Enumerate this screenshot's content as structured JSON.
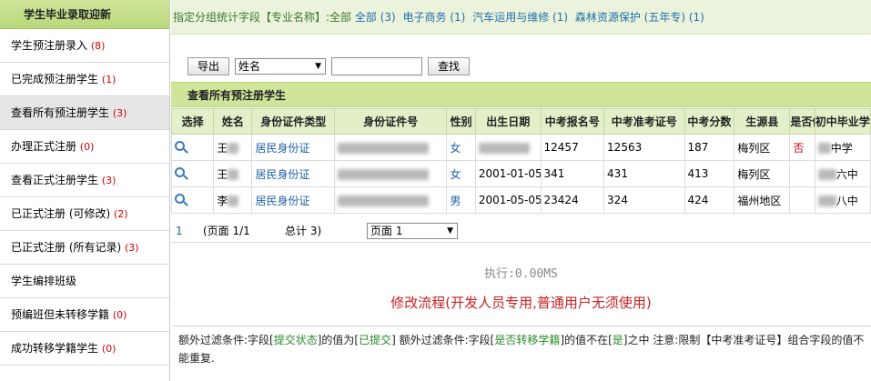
{
  "sidebar": {
    "header": "学生毕业录取迎新",
    "items": [
      {
        "label": "学生预注册录入",
        "count": "(8)"
      },
      {
        "label": "已完成预注册学生",
        "count": "(1)"
      },
      {
        "label": "查看所有预注册学生",
        "count": "(3)"
      },
      {
        "label": "办理正式注册",
        "count": "(0)"
      },
      {
        "label": "查看正式注册学生",
        "count": "(3)"
      },
      {
        "label": "已正式注册 (可修改)",
        "count": "(2)"
      },
      {
        "label": "已正式注册 (所有记录)",
        "count": "(3)"
      },
      {
        "label": "学生编排班级",
        "count": ""
      },
      {
        "label": "预编班但未转移学籍",
        "count": "(0)"
      },
      {
        "label": "成功转移学籍学生",
        "count": "(0)"
      }
    ]
  },
  "filterbar": {
    "prefix": "指定分组统计字段【专业名称】:全部",
    "links": [
      "全部 (3)",
      "电子商务 (1)",
      "汽车运用与维修 (1)",
      "森林资源保护 (五年专) (1)"
    ]
  },
  "toolbar": {
    "export_label": "导出",
    "field_select": "姓名",
    "search_value": "",
    "search_label": "查找"
  },
  "grid": {
    "title": "查看所有预注册学生",
    "columns": [
      "选择",
      "姓名",
      "身份证件类型",
      "身份证件号",
      "性别",
      "出生日期",
      "中考报名号",
      "中考准考证号",
      "中考分数",
      "生源县",
      "是否低保",
      "初中毕业学校"
    ],
    "rows": [
      {
        "name": "王",
        "id_type": "居民身份证",
        "gender": "女",
        "birth": "",
        "reg_no": "12457",
        "exam_no": "12563",
        "score": "187",
        "county": "梅列区",
        "low_income": "否",
        "school": "中学"
      },
      {
        "name": "王",
        "id_type": "居民身份证",
        "gender": "女",
        "birth": "2001-01-05",
        "reg_no": "341",
        "exam_no": "431",
        "score": "413",
        "county": "梅列区",
        "low_income": "",
        "school": "六中"
      },
      {
        "name": "李",
        "id_type": "居民身份证",
        "gender": "男",
        "birth": "2001-05-05",
        "reg_no": "23424",
        "exam_no": "324",
        "score": "424",
        "county": "福州地区",
        "low_income": "",
        "school": "八中"
      }
    ]
  },
  "pager": {
    "page_number": "1",
    "page_label": "(页面 1/1",
    "total_label": "总计 3)",
    "page_select": "页面 1"
  },
  "exec_text": "执行:0.00MS",
  "workflow_text": "修改流程(开发人员专用,普通用户无须使用)",
  "note": {
    "p1": "额外过滤条件:字段[",
    "f1": "提交状态",
    "p2": "]的值为[",
    "v1": "已提交",
    "p3": "] 额外过滤条件:字段[",
    "f2": "是否转移学籍",
    "p4": "]的值不在[",
    "v2": "是",
    "p5": "]之中 注意:限制【中考准考证号】组合字段的值不能重复."
  }
}
